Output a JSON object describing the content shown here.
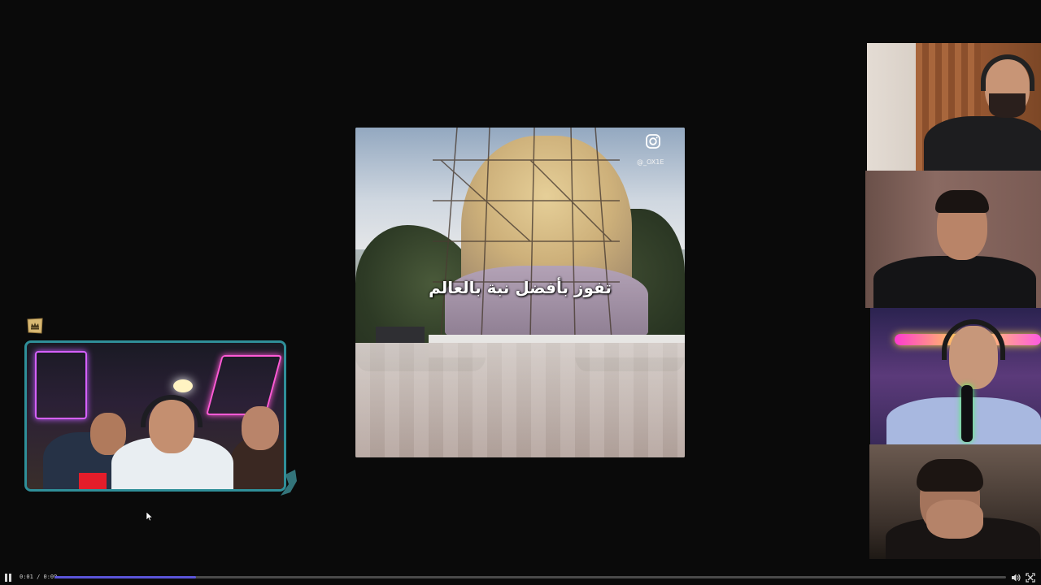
{
  "center_video": {
    "caption": "تفوز بأفضل نبة بالعالم",
    "watermark_handle": "@_OX1E",
    "watermark_icon": "instagram-icon"
  },
  "player": {
    "time_display": "0:01 / 0:09",
    "progress_fraction": 0.149,
    "accent_color": "#5b55d9",
    "icons": {
      "play_pause": "pause-icon",
      "volume": "volume-icon",
      "fullscreen": "fullscreen-icon"
    }
  },
  "overlays": {
    "badge_icon": "crown-badge-icon",
    "left_cam_border_color": "#2f8f99"
  }
}
